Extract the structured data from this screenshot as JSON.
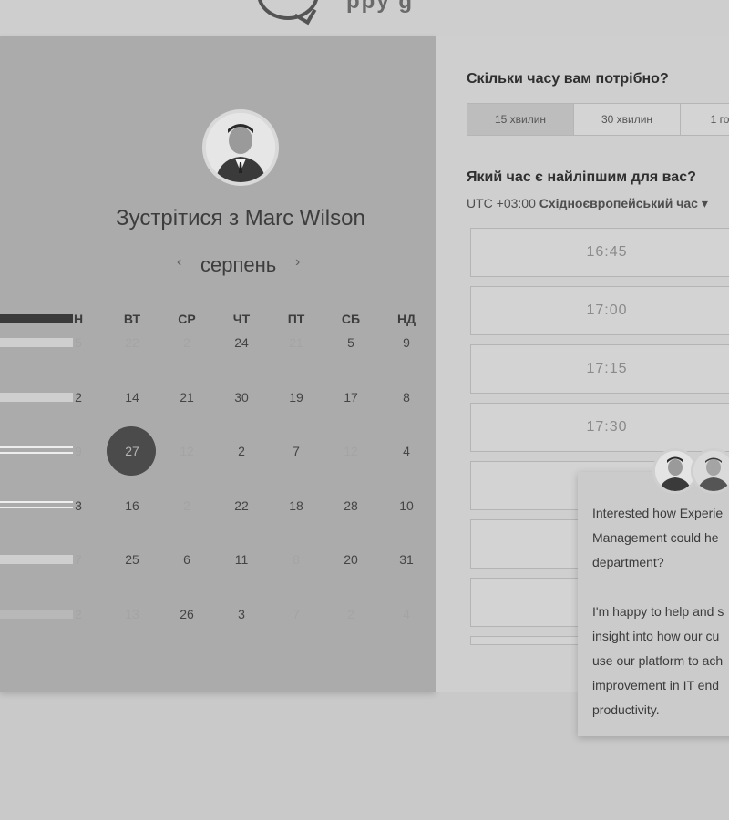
{
  "logo": {
    "text": "ppy g"
  },
  "profile": {
    "title": "Зустрітися з Marc Wilson"
  },
  "calendar": {
    "month": "серпень",
    "prev_icon": "chevron-left-icon",
    "next_icon": "chevron-right-icon",
    "headers": [
      "Н",
      "ВТ",
      "СР",
      "ЧТ",
      "ПТ",
      "СБ",
      "НД"
    ],
    "weeks": [
      [
        "5",
        "22",
        "2",
        "24",
        "21",
        "5",
        "9"
      ],
      [
        "2",
        "14",
        "21",
        "30",
        "19",
        "17",
        "8"
      ],
      [
        "9",
        "27",
        "12",
        "2",
        "7",
        "12",
        "4"
      ],
      [
        "3",
        "16",
        "2",
        "22",
        "18",
        "28",
        "10"
      ],
      [
        "7",
        "25",
        "6",
        "11",
        "8",
        "20",
        "31"
      ],
      [
        "2",
        "13",
        "26",
        "3",
        "7",
        "2",
        "4"
      ]
    ],
    "selected_day": "27"
  },
  "duration": {
    "question": "Скільки часу вам потрібно?",
    "options": [
      "15 хвилин",
      "30 хвилин",
      "1 го"
    ],
    "selected": "15 хвилин"
  },
  "time": {
    "question": "Який час є найліпшим для вас?",
    "timezone_prefix": "UTC +03:00",
    "timezone_name": "Східноєвропейський час",
    "slots": [
      "16:45",
      "17:00",
      "17:15",
      "17:30",
      "",
      "",
      ""
    ]
  },
  "chat": {
    "message": "Interested how Experie\nManagement could he\ndepartment?\n\nI'm happy to help and s\ninsight into how our cu\nuse our platform to ach\nimprovement in IT end\nproductivity."
  }
}
